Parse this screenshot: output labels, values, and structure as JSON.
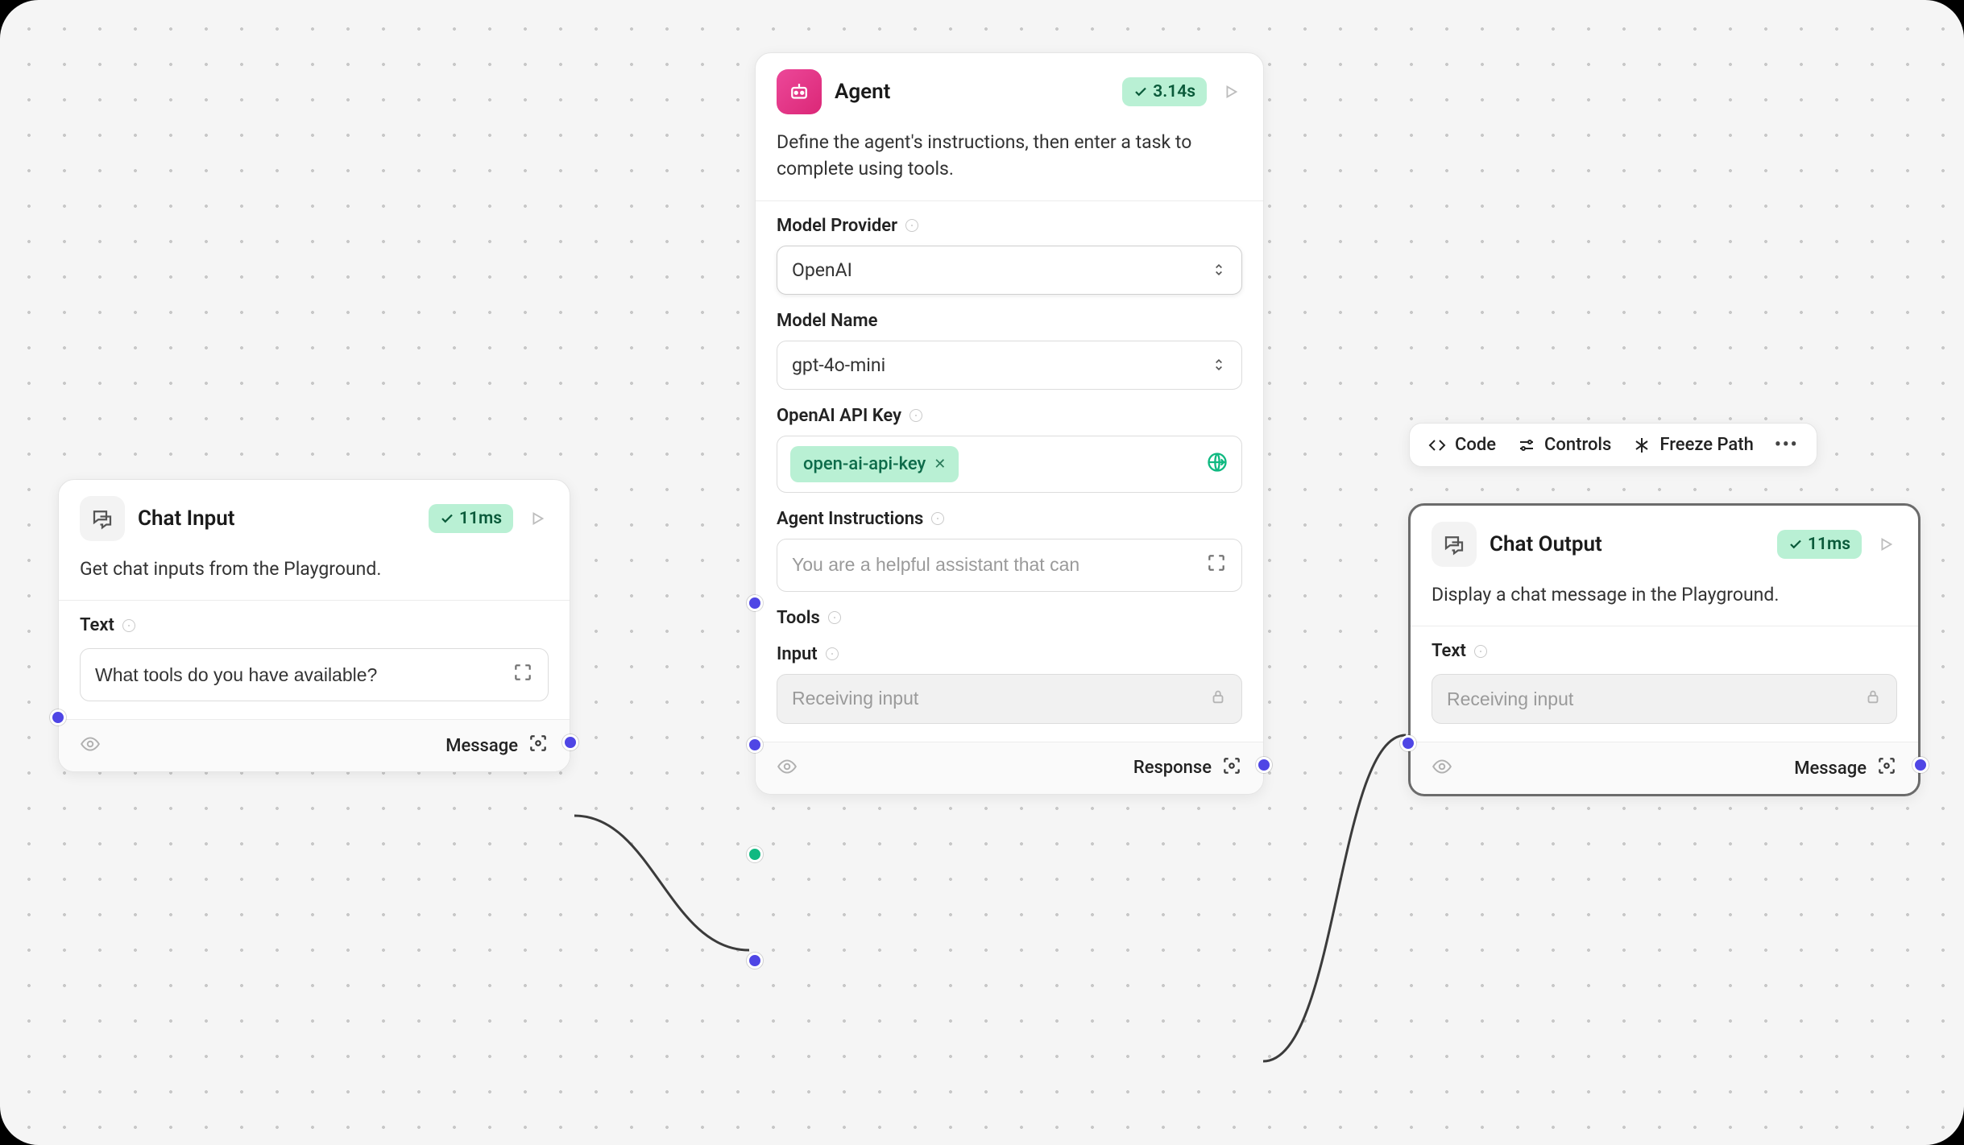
{
  "toolbar": {
    "code": "Code",
    "controls": "Controls",
    "freeze_path": "Freeze Path"
  },
  "nodes": {
    "chat_input": {
      "title": "Chat Input",
      "timing": "11ms",
      "description": "Get chat inputs from the Playground.",
      "fields": {
        "text_label": "Text",
        "text_value": "What tools do you have available?"
      },
      "output_label": "Message"
    },
    "agent": {
      "title": "Agent",
      "timing": "3.14s",
      "description": "Define the agent's instructions, then enter a task to complete using tools.",
      "fields": {
        "model_provider_label": "Model Provider",
        "model_provider_value": "OpenAI",
        "model_name_label": "Model Name",
        "model_name_value": "gpt-4o-mini",
        "api_key_label": "OpenAI API Key",
        "api_key_chip": "open-ai-api-key",
        "instructions_label": "Agent Instructions",
        "instructions_value": "You are a helpful assistant that can",
        "tools_label": "Tools",
        "input_label": "Input",
        "input_value": "Receiving input"
      },
      "output_label": "Response"
    },
    "chat_output": {
      "title": "Chat Output",
      "timing": "11ms",
      "description": "Display a chat message in the Playground.",
      "fields": {
        "text_label": "Text",
        "text_value": "Receiving input"
      },
      "output_label": "Message"
    }
  },
  "colors": {
    "accent_pink": "#ec4899",
    "badge_green_bg": "#b9f0d4",
    "badge_green_fg": "#0a5a3a",
    "port_blue": "#4f46e5",
    "port_teal": "#10b981"
  }
}
